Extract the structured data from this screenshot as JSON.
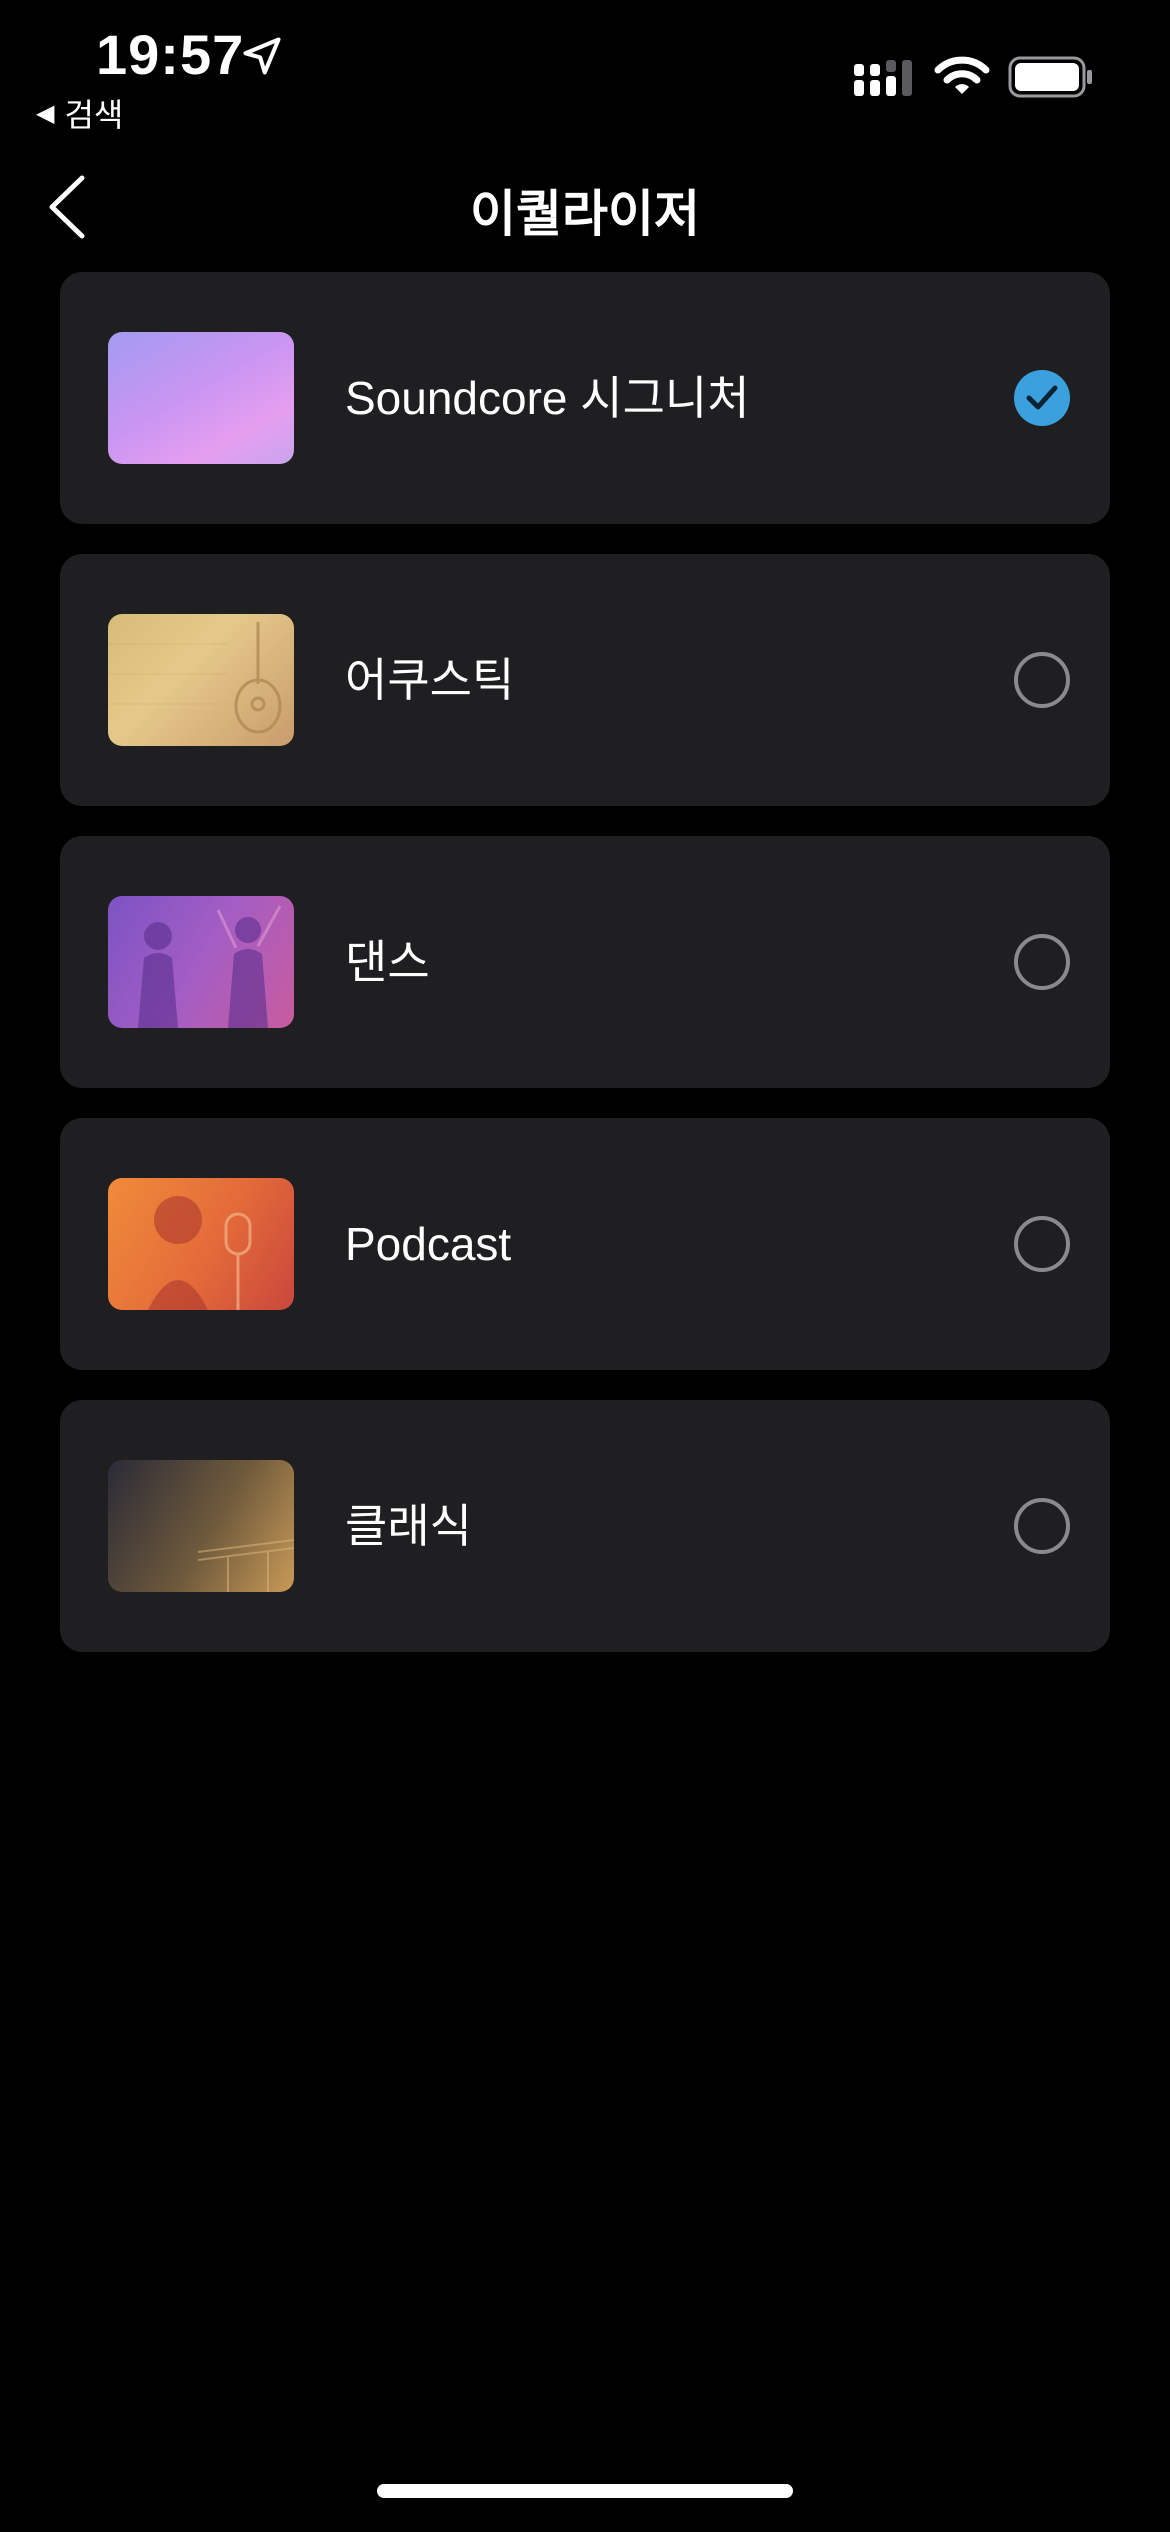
{
  "status": {
    "time": "19:57",
    "back_app_label": "검색"
  },
  "nav": {
    "title": "이퀄라이저"
  },
  "presets": [
    {
      "label": "Soundcore 시그니처",
      "selected": true,
      "thumb": "gradient-purple-pink"
    },
    {
      "label": "어쿠스틱",
      "selected": false,
      "thumb": "acoustic-guitar"
    },
    {
      "label": "댄스",
      "selected": false,
      "thumb": "dance-crowd"
    },
    {
      "label": "Podcast",
      "selected": false,
      "thumb": "singer-microphone"
    },
    {
      "label": "클래식",
      "selected": false,
      "thumb": "classical-piano"
    }
  ],
  "colors": {
    "accent": "#3aa0de",
    "card_bg": "#1f1f22",
    "radio_border": "#8a8a8e"
  }
}
